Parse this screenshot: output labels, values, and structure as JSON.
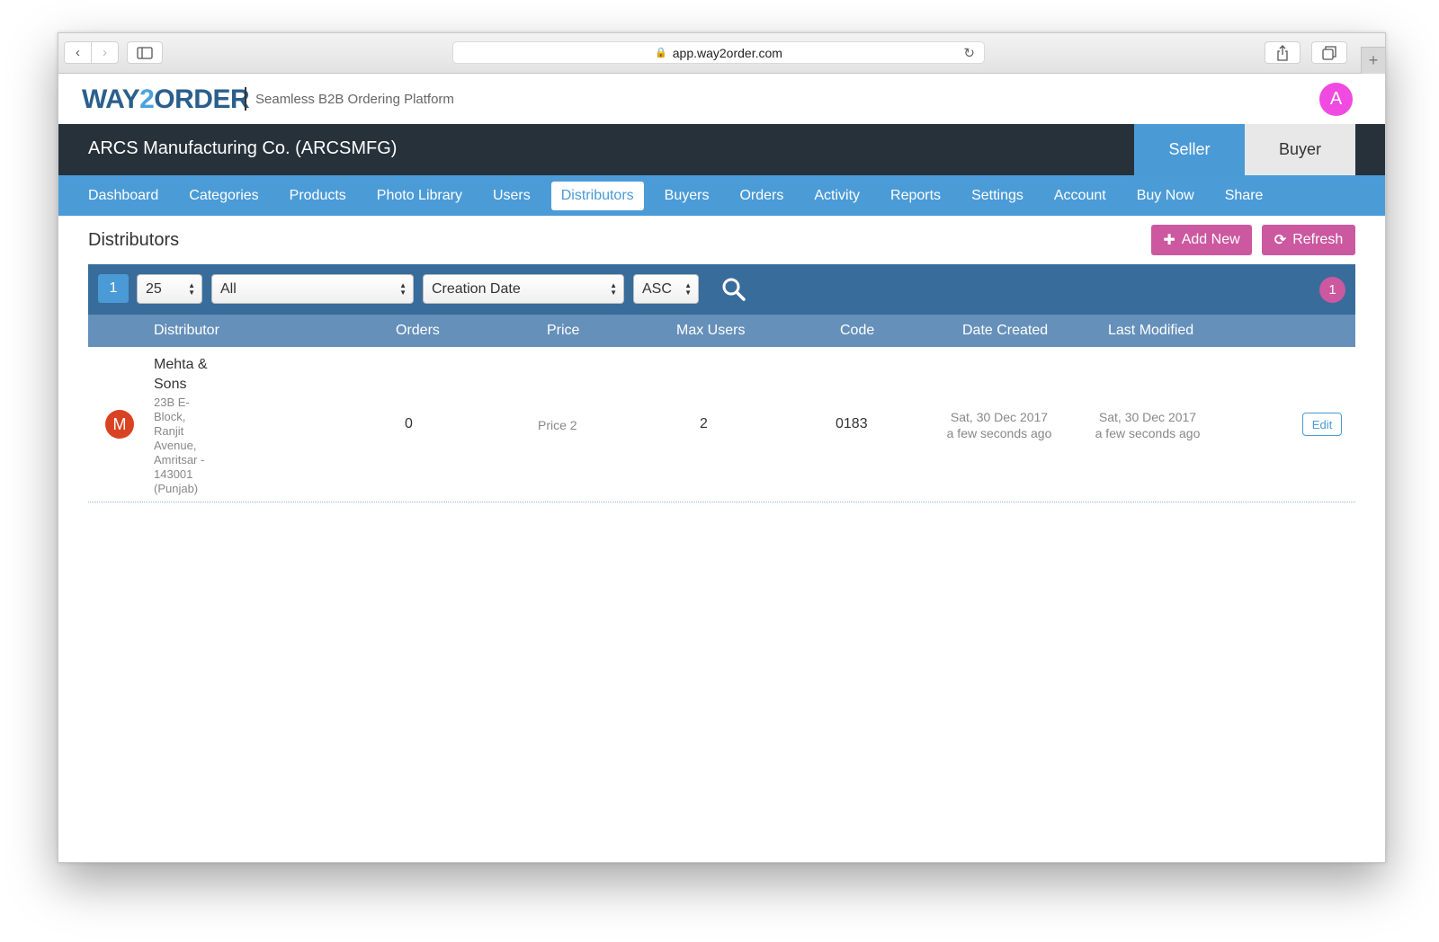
{
  "browser": {
    "url": "app.way2order.com"
  },
  "header": {
    "logo_part1": "WAY",
    "logo_part2": "2",
    "logo_part3": "ORDER",
    "tagline": "Seamless B2B Ordering Platform",
    "avatar_letter": "A"
  },
  "company": {
    "name": "ARCS Manufacturing Co. (ARCSMFG)",
    "mode_seller": "Seller",
    "mode_buyer": "Buyer"
  },
  "nav": {
    "items": [
      {
        "label": "Dashboard"
      },
      {
        "label": "Categories"
      },
      {
        "label": "Products"
      },
      {
        "label": "Photo Library"
      },
      {
        "label": "Users"
      },
      {
        "label": "Distributors"
      },
      {
        "label": "Buyers"
      },
      {
        "label": "Orders"
      },
      {
        "label": "Activity"
      },
      {
        "label": "Reports"
      },
      {
        "label": "Settings"
      },
      {
        "label": "Account"
      },
      {
        "label": "Buy Now"
      },
      {
        "label": "Share"
      }
    ],
    "active": "Distributors"
  },
  "page": {
    "title": "Distributors",
    "add_label": "Add New",
    "refresh_label": "Refresh"
  },
  "toolbar": {
    "page_number": "1",
    "page_size": "25",
    "filter": "All",
    "sort_by": "Creation Date",
    "sort_order": "ASC",
    "result_count": "1"
  },
  "table": {
    "headers": {
      "distributor": "Distributor",
      "orders": "Orders",
      "price": "Price",
      "max_users": "Max Users",
      "code": "Code",
      "date_created": "Date Created",
      "last_modified": "Last Modified"
    },
    "rows": [
      {
        "avatar": "M",
        "name": "Mehta & Sons",
        "address": "23B E-Block, Ranjit Avenue, Amritsar - 143001 (Punjab)",
        "orders": "0",
        "price": "Price 2",
        "max_users": "2",
        "code": "0183",
        "date_created": "Sat, 30 Dec 2017",
        "date_created_rel": "a few seconds ago",
        "last_modified": "Sat, 30 Dec 2017",
        "last_modified_rel": "a few seconds ago",
        "edit_label": "Edit"
      }
    ]
  },
  "colors": {
    "brand_blue": "#4b9bd7",
    "dark_bar": "#26313a",
    "toolbar_blue": "#386c9b",
    "header_blue": "#6590ba",
    "pink": "#cc58a0",
    "avatar_pink": "#f04ae0",
    "avatar_red": "#d94222"
  },
  "icons": {
    "back": "chevron-left-icon",
    "forward": "chevron-right-icon",
    "sidebar": "sidebar-icon",
    "lock": "lock-icon",
    "reload": "reload-icon",
    "share": "share-icon",
    "tabs": "tabs-icon",
    "new_tab": "plus-icon",
    "add": "plus-icon",
    "refresh": "refresh-icon",
    "search": "search-icon"
  }
}
